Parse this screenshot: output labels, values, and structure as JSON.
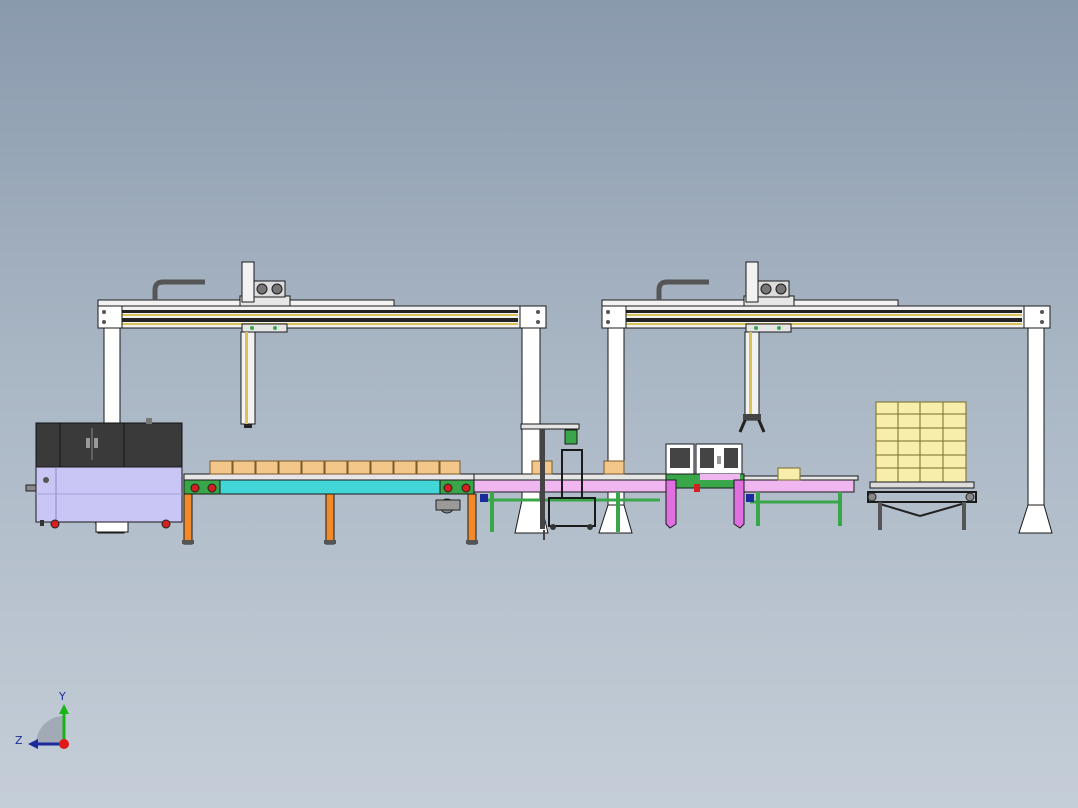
{
  "viewport": {
    "background_top": "#8a9aad",
    "background_bottom": "#c5ced8"
  },
  "colors": {
    "outline": "#1a1a1a",
    "gantry_frame": "#f2f2f2",
    "gantry_rail_dark": "#222222",
    "gantry_rail_accent": "#d8c25a",
    "packer_body": "#c9c6f5",
    "packer_top": "#3a3a3a",
    "conveyor_cyan": "#43d6d6",
    "conveyor_pink": "#f0b6f0",
    "conveyor_green": "#3aa64a",
    "support_orange": "#f08a2a",
    "carton": "#f3c68a",
    "pallet_box": "#f6eeaa",
    "magenta_leg": "#e070e0",
    "accent_red": "#d62020"
  },
  "axis_triad": {
    "y_label": "Y",
    "z_label": "Z",
    "y_color": "#18b418",
    "z_color": "#1b2a9c",
    "origin_color": "#e01818"
  }
}
